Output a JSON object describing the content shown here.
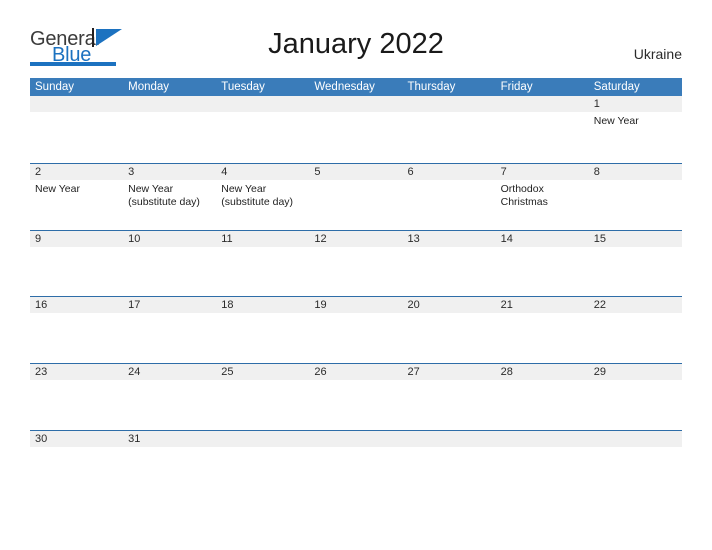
{
  "brand": {
    "name_part1": "General",
    "name_part2": "Blue",
    "color_primary": "#1c72c0"
  },
  "header": {
    "title": "January 2022",
    "country": "Ukraine"
  },
  "theme": {
    "header_blue": "#3a7cba",
    "row_divider_blue": "#2e6da8",
    "daynum_band_gray": "#f0f0f0"
  },
  "calendar": {
    "weekdays": [
      "Sunday",
      "Monday",
      "Tuesday",
      "Wednesday",
      "Thursday",
      "Friday",
      "Saturday"
    ],
    "weeks": [
      {
        "days": [
          {
            "num": "",
            "events": []
          },
          {
            "num": "",
            "events": []
          },
          {
            "num": "",
            "events": []
          },
          {
            "num": "",
            "events": []
          },
          {
            "num": "",
            "events": []
          },
          {
            "num": "",
            "events": []
          },
          {
            "num": "1",
            "events": [
              "New Year"
            ]
          }
        ]
      },
      {
        "days": [
          {
            "num": "2",
            "events": [
              "New Year"
            ]
          },
          {
            "num": "3",
            "events": [
              "New Year",
              "(substitute day)"
            ]
          },
          {
            "num": "4",
            "events": [
              "New Year",
              "(substitute day)"
            ]
          },
          {
            "num": "5",
            "events": []
          },
          {
            "num": "6",
            "events": []
          },
          {
            "num": "7",
            "events": [
              "Orthodox",
              "Christmas"
            ]
          },
          {
            "num": "8",
            "events": []
          }
        ]
      },
      {
        "days": [
          {
            "num": "9",
            "events": []
          },
          {
            "num": "10",
            "events": []
          },
          {
            "num": "11",
            "events": []
          },
          {
            "num": "12",
            "events": []
          },
          {
            "num": "13",
            "events": []
          },
          {
            "num": "14",
            "events": []
          },
          {
            "num": "15",
            "events": []
          }
        ]
      },
      {
        "days": [
          {
            "num": "16",
            "events": []
          },
          {
            "num": "17",
            "events": []
          },
          {
            "num": "18",
            "events": []
          },
          {
            "num": "19",
            "events": []
          },
          {
            "num": "20",
            "events": []
          },
          {
            "num": "21",
            "events": []
          },
          {
            "num": "22",
            "events": []
          }
        ]
      },
      {
        "days": [
          {
            "num": "23",
            "events": []
          },
          {
            "num": "24",
            "events": []
          },
          {
            "num": "25",
            "events": []
          },
          {
            "num": "26",
            "events": []
          },
          {
            "num": "27",
            "events": []
          },
          {
            "num": "28",
            "events": []
          },
          {
            "num": "29",
            "events": []
          }
        ]
      },
      {
        "days": [
          {
            "num": "30",
            "events": []
          },
          {
            "num": "31",
            "events": []
          },
          {
            "num": "",
            "events": []
          },
          {
            "num": "",
            "events": []
          },
          {
            "num": "",
            "events": []
          },
          {
            "num": "",
            "events": []
          },
          {
            "num": "",
            "events": []
          }
        ]
      }
    ]
  }
}
